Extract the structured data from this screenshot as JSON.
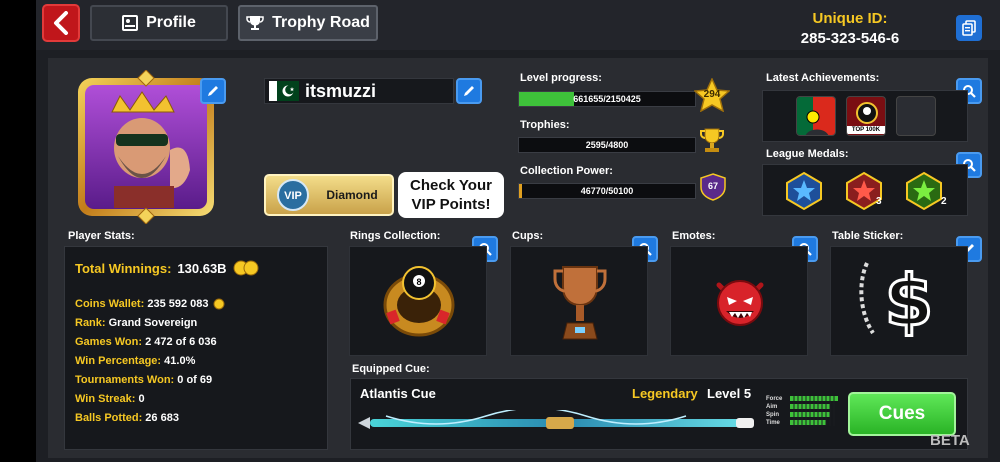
{
  "nav": {
    "tabs": [
      {
        "label": "Profile"
      },
      {
        "label": "Trophy Road"
      }
    ]
  },
  "header": {
    "unique_id_label": "Unique ID:",
    "unique_id_value": "285-323-546-6"
  },
  "player": {
    "name": "itsmuzzi",
    "vip_tier": "Diamond",
    "vip_callout": "Check Your VIP Points!"
  },
  "progress": {
    "level_label": "Level progress:",
    "level_value": "661655/2150425",
    "level_fraction": 0.31,
    "level_number": "294",
    "trophies_label": "Trophies:",
    "trophies_value": "2595/4800",
    "trophies_fraction": 0.0,
    "collection_label": "Collection Power:",
    "collection_value": "46770/50100",
    "collection_fraction": 0.015,
    "collection_badge": "67"
  },
  "achievements": {
    "label": "Latest Achievements:",
    "top_badge_text": "TOP 100K"
  },
  "league": {
    "label": "League Medals:",
    "medals": [
      {
        "count": ""
      },
      {
        "count": "3"
      },
      {
        "count": "2"
      }
    ]
  },
  "stats": {
    "label": "Player Stats:",
    "total_winnings_label": "Total Winnings:",
    "total_winnings_value": "130.63B",
    "coins_label": "Coins Wallet:",
    "coins_value": "235 592 083",
    "rank_label": "Rank:",
    "rank_value": "Grand Sovereign",
    "games_won_label": "Games Won:",
    "games_won_value": "2 472 of 6 036",
    "win_pct_label": "Win Percentage:",
    "win_pct_value": "41.0%",
    "tournaments_label": "Tournaments Won:",
    "tournaments_value": "0 of 69",
    "streak_label": "Win Streak:",
    "streak_value": "0",
    "potted_label": "Balls Potted:",
    "potted_value": "26 683"
  },
  "collections": {
    "rings_label": "Rings Collection:",
    "cups_label": "Cups:",
    "emotes_label": "Emotes:",
    "sticker_label": "Table Sticker:"
  },
  "cue": {
    "section_label": "Equipped Cue:",
    "name": "Atlantis Cue",
    "rarity": "Legendary",
    "level": "Level 5",
    "attr_labels": [
      "Force",
      "Aim",
      "Spin",
      "Time"
    ],
    "cues_button": "Cues"
  },
  "beta_label": "BETA",
  "colors": {
    "accent_gold": "#f6c823",
    "button_blue": "#1f7ae0",
    "back_red": "#c0161b",
    "cues_green": "#3fd23a"
  }
}
